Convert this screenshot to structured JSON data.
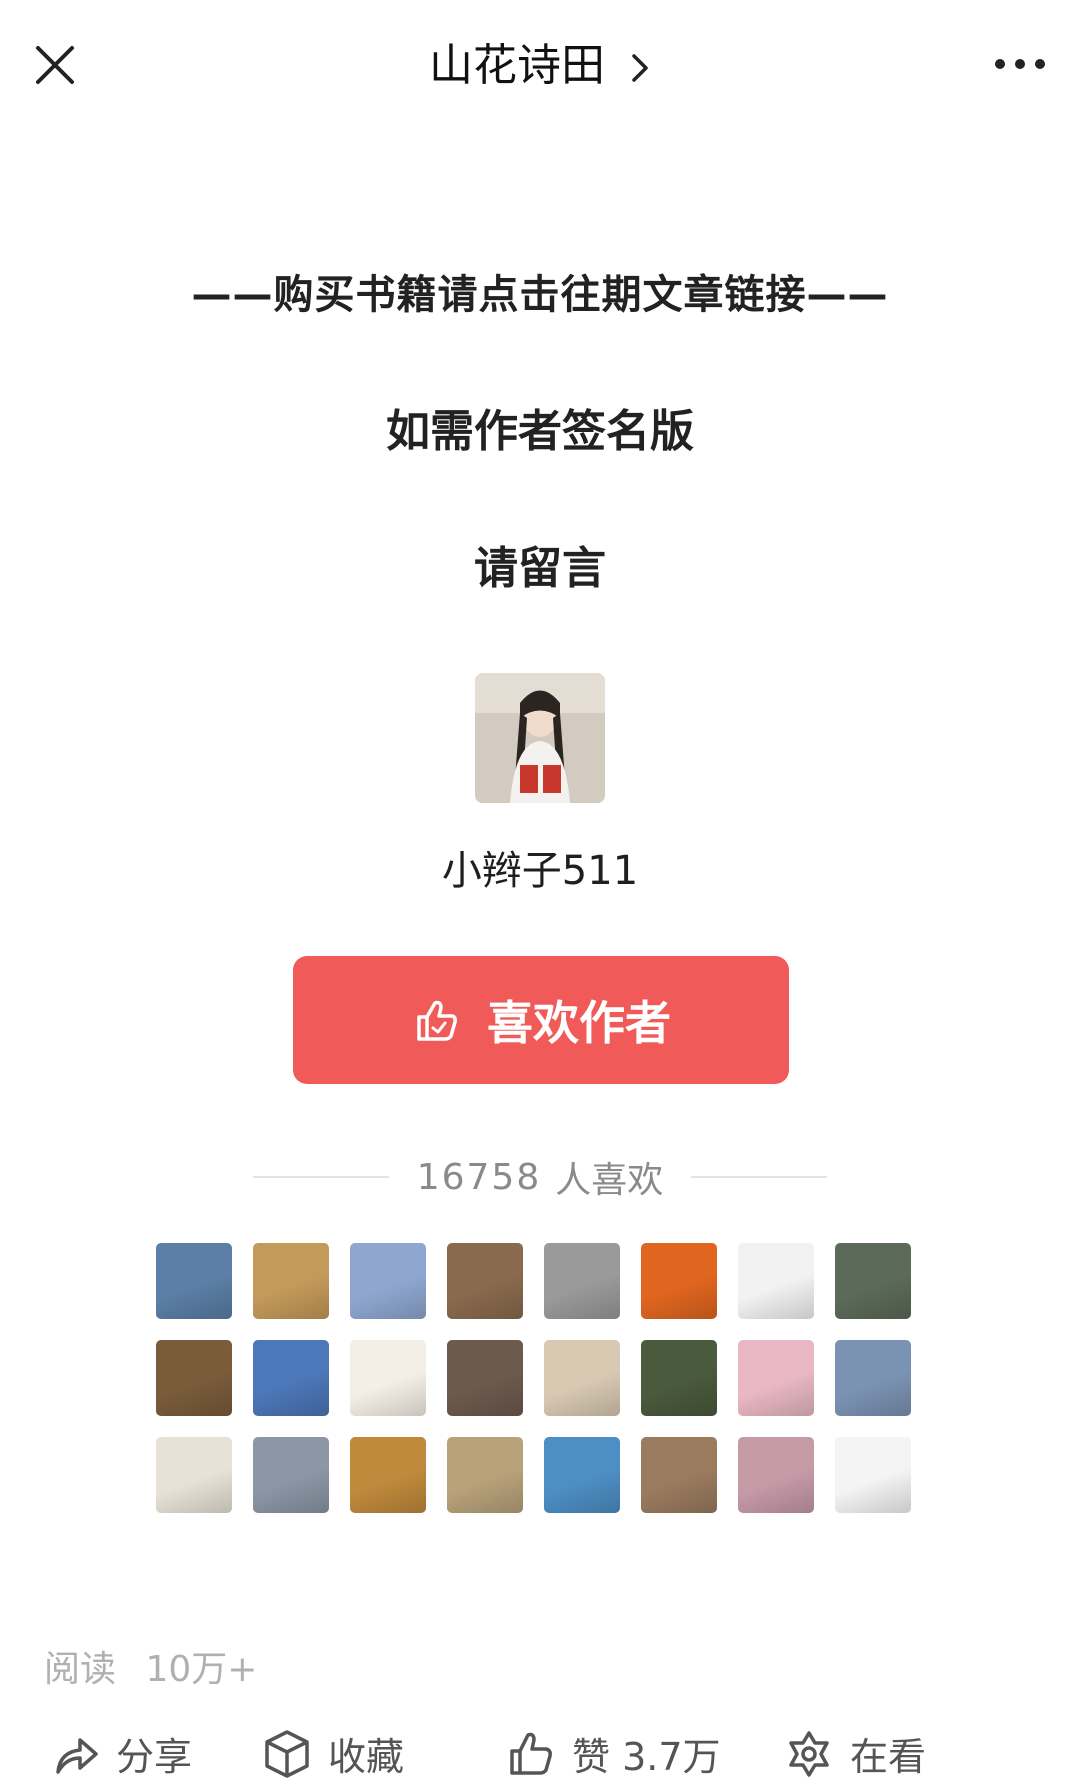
{
  "topbar": {
    "title": "山花诗田",
    "close_icon": "close-icon",
    "more_icon": "more-icon"
  },
  "content": {
    "line1": "——购买书籍请点击往期文章链接——",
    "line2": "如需作者签名版",
    "line3": "请留言"
  },
  "author": {
    "name": "小辫子511"
  },
  "like_button": {
    "label": "喜欢作者",
    "icon": "thumb-up-icon",
    "color": "#f05b5a"
  },
  "likes": {
    "count": "16758",
    "suffix": "人喜欢"
  },
  "fans": [
    {
      "name": "fan-1",
      "color": "#5b7fa6"
    },
    {
      "name": "fan-2",
      "color": "#c49a5a"
    },
    {
      "name": "fan-3",
      "color": "#8fa7d0"
    },
    {
      "name": "fan-4",
      "color": "#8a6a4e"
    },
    {
      "name": "fan-5",
      "color": "#9a9a9a"
    },
    {
      "name": "fan-6",
      "color": "#e0661f"
    },
    {
      "name": "fan-7",
      "color": "#f2f2f2"
    },
    {
      "name": "fan-8",
      "color": "#5c6b58"
    },
    {
      "name": "fan-9",
      "color": "#7a5c3a"
    },
    {
      "name": "fan-10",
      "color": "#4c77b8"
    },
    {
      "name": "fan-11",
      "color": "#f4efe6"
    },
    {
      "name": "fan-12",
      "color": "#6d5a4e"
    },
    {
      "name": "fan-13",
      "color": "#d8c9b3"
    },
    {
      "name": "fan-14",
      "color": "#4a5a3c"
    },
    {
      "name": "fan-15",
      "color": "#e9b8c4"
    },
    {
      "name": "fan-16",
      "color": "#7b93b3"
    },
    {
      "name": "fan-17",
      "color": "#e8e2d6"
    },
    {
      "name": "fan-18",
      "color": "#8b97a6"
    },
    {
      "name": "fan-19",
      "color": "#c08a3c"
    },
    {
      "name": "fan-20",
      "color": "#b8a27a"
    },
    {
      "name": "fan-21",
      "color": "#4d8fc4"
    },
    {
      "name": "fan-22",
      "color": "#9b7b5f"
    },
    {
      "name": "fan-23",
      "color": "#c79aa8"
    },
    {
      "name": "fan-24",
      "color": "#f4f4f4"
    }
  ],
  "read": {
    "label": "阅读",
    "value": "10万+"
  },
  "bottom_bar": {
    "share": "分享",
    "favorite": "收藏",
    "like": "赞 3.7万",
    "wow": "在看"
  }
}
